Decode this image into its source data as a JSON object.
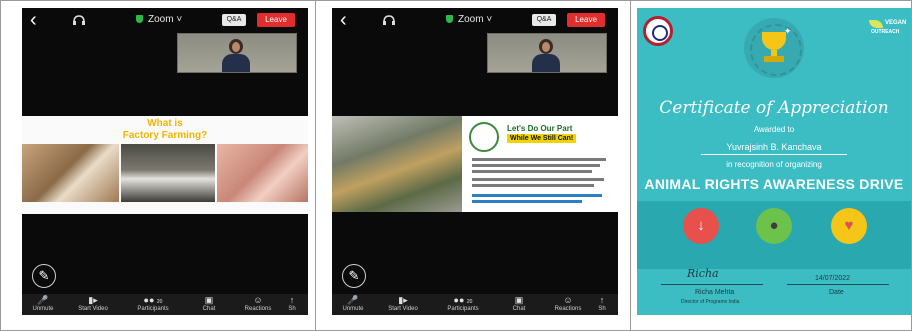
{
  "zoom_ui": {
    "app_name": "Zoom",
    "qa_label": "Q&A",
    "leave_label": "Leave",
    "toolbar": {
      "unmute": "Unmute",
      "start_video": "Start Video",
      "participants": "Participants",
      "participants_count": "20",
      "chat": "Chat",
      "reactions": "Reactions",
      "share": "Sh"
    }
  },
  "slide1": {
    "title_line1": "What is",
    "title_line2": "Factory Farming?"
  },
  "slide2": {
    "heading_line1": "Let's Do Our Part",
    "heading_line2": "While We Still Can!"
  },
  "certificate": {
    "title": "Certificate of Appreciation",
    "awarded_to_label": "Awarded to",
    "recipient": "Yuvrajsinh B. Kanchava",
    "recognition_text": "in recognition of organizing",
    "event": "ANIMAL RIGHTS AWARENESS DRIVE",
    "logo_line1": "VEGAN",
    "logo_line2": "OUTREACH",
    "signatory_name": "Richa Mehta",
    "signatory_title": "Director of Programs India",
    "date_value": "14/07/2022",
    "date_label": "Date"
  },
  "colors": {
    "certificate_bg": "#3cbdc4",
    "leave_red": "#e02d2d",
    "slide_title_yellow": "#f2b400",
    "trophy_gold": "#f5c518"
  }
}
